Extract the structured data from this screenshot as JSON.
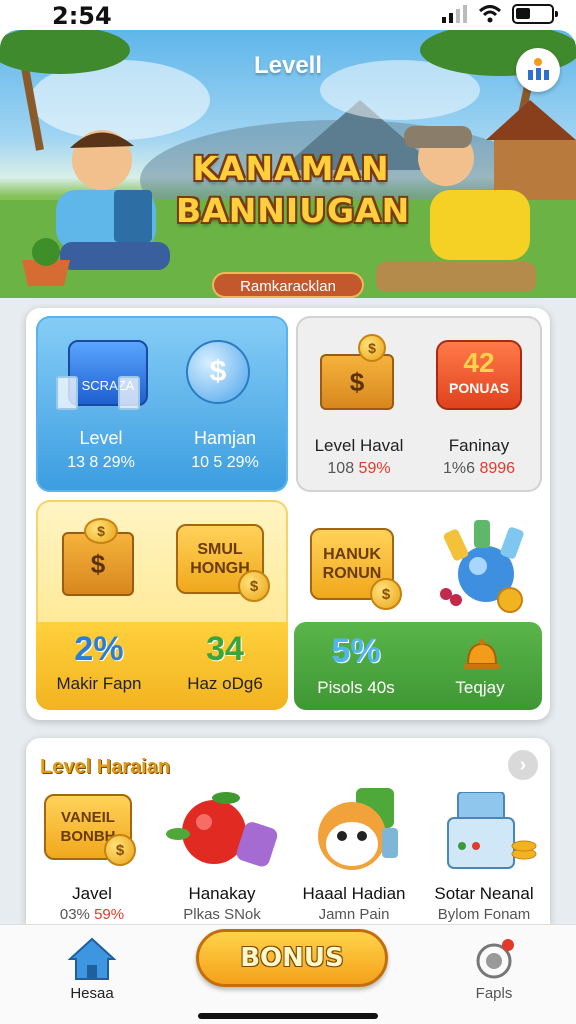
{
  "status_bar": {
    "time": "2:54"
  },
  "hero": {
    "title": "Levell",
    "headline_line1": "KANAMAN",
    "headline_line2": "BANNIUGAN",
    "subtitle": "Ramkaracklan"
  },
  "grid": {
    "blue_card": {
      "badge_text": "SCRAZA",
      "item1": {
        "label": "Level",
        "value": "13 8 29%"
      },
      "item2": {
        "label": "Hamjan",
        "value": "10 5 29%"
      }
    },
    "gray_card": {
      "badge_number": "42",
      "badge_text": "PONUAS",
      "item1": {
        "label": "Level Haval",
        "value_prefix": "108 ",
        "value_highlight": "59%"
      },
      "item2": {
        "label": "Faninay",
        "value_prefix": "1%6 ",
        "value_highlight": "8996"
      }
    },
    "yellow_card": {
      "bubble_text_line1": "SMUL",
      "bubble_text_line2": "HONGH",
      "stat1": {
        "value": "2%",
        "label": "Makir Fapn"
      },
      "stat2": {
        "value": "34",
        "label": "Haz oDg6"
      }
    },
    "white_card": {
      "bubble_text_line1": "HANUK",
      "bubble_text_line2": "RONUN"
    },
    "green_card": {
      "stat1": {
        "value": "5%",
        "label": "Pisols 40s"
      },
      "stat2": {
        "label": "Teqjay"
      }
    }
  },
  "section": {
    "title": "Level Haraian",
    "items": [
      {
        "badge_line1": "VANEIL",
        "badge_line2": "BONBH",
        "name": "Javel",
        "value_prefix": "03% ",
        "value_highlight": "59%"
      },
      {
        "name": "Hanakay",
        "value": "Plkas SNok"
      },
      {
        "name": "Haaal Hadian",
        "value": "Jamn Pain"
      },
      {
        "name": "Sotar Neanal",
        "value": "Bylom Fonam"
      }
    ]
  },
  "nav": {
    "home_label": "Hesaa",
    "bonus_label": "BONUS",
    "faqs_label": "Fapls"
  },
  "colors": {
    "accent_orange": "#f4a11a",
    "blue_card": "#3b9de0",
    "green_card": "#4aa83f",
    "highlight_red": "#e03b2a"
  }
}
